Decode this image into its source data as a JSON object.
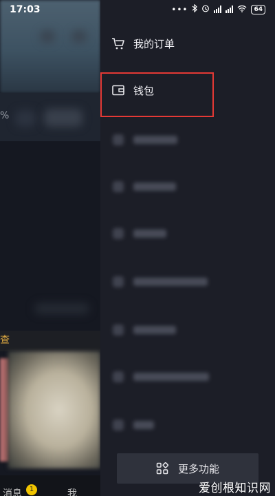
{
  "status_bar": {
    "time": "17:03",
    "battery": "64",
    "icons": [
      "dots-icon",
      "bluetooth-icon",
      "alarm-icon",
      "signal-hd-icon",
      "signal-icon",
      "wifi-icon",
      "battery-icon"
    ]
  },
  "background": {
    "percent_text": "%",
    "yellow_text": "查",
    "tab_messages": "消息",
    "tab_me": "我",
    "badge_count": "1"
  },
  "drawer": {
    "items": [
      {
        "label": "我的订单",
        "icon": "cart-icon"
      },
      {
        "label": "钱包",
        "icon": "wallet-icon"
      }
    ],
    "more_button_label": "更多功能",
    "more_button_icon": "grid-icon"
  },
  "watermark": "爱创根知识网",
  "colors": {
    "drawer_bg": "#1c1e27",
    "highlight_border": "#e53935",
    "more_button_bg": "#2f323c"
  }
}
